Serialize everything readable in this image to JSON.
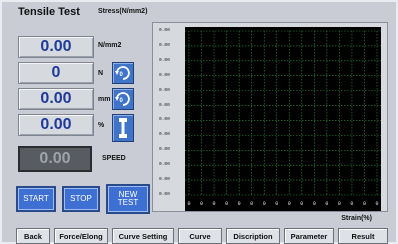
{
  "title": "Tensile Test",
  "stress_label": "Stress(N/mm2)",
  "readouts": [
    {
      "value": "0.00",
      "unit": "N/mm2"
    },
    {
      "value": "0",
      "unit": "N"
    },
    {
      "value": "0.00",
      "unit": "mm"
    },
    {
      "value": "0.00",
      "unit": "%"
    }
  ],
  "speed": {
    "value": "0.00",
    "label": "SPEED"
  },
  "buttons": {
    "start": "START",
    "stop": "STOP",
    "new_test": "NEW TEST"
  },
  "icons": [
    "reset-force-icon",
    "reset-displacement-icon",
    "specimen-icon"
  ],
  "chart": {
    "y_ticks": [
      "0.00",
      "0.00",
      "0.00",
      "0.00",
      "0.00",
      "0.00",
      "0.00",
      "0.00",
      "0.00",
      "0.00",
      "0.00",
      "0.00"
    ],
    "x_ticks": [
      "0",
      "0",
      "0",
      "0",
      "0",
      "0",
      "0",
      "0",
      "0",
      "0",
      "0",
      "0",
      "0",
      "0",
      "0",
      "0"
    ],
    "x_label": "Strain(%)",
    "plot_color": "#000000",
    "grid_color": "#2f8f3a"
  },
  "nav": [
    "Back",
    "Force/Elong",
    "Curve Setting",
    "Curve",
    "Discription",
    "Parameter",
    "Result"
  ],
  "colors": {
    "value_text": "#1e3a9a",
    "button_blue": "#3e6fd2",
    "background": "#c9ccd5"
  }
}
